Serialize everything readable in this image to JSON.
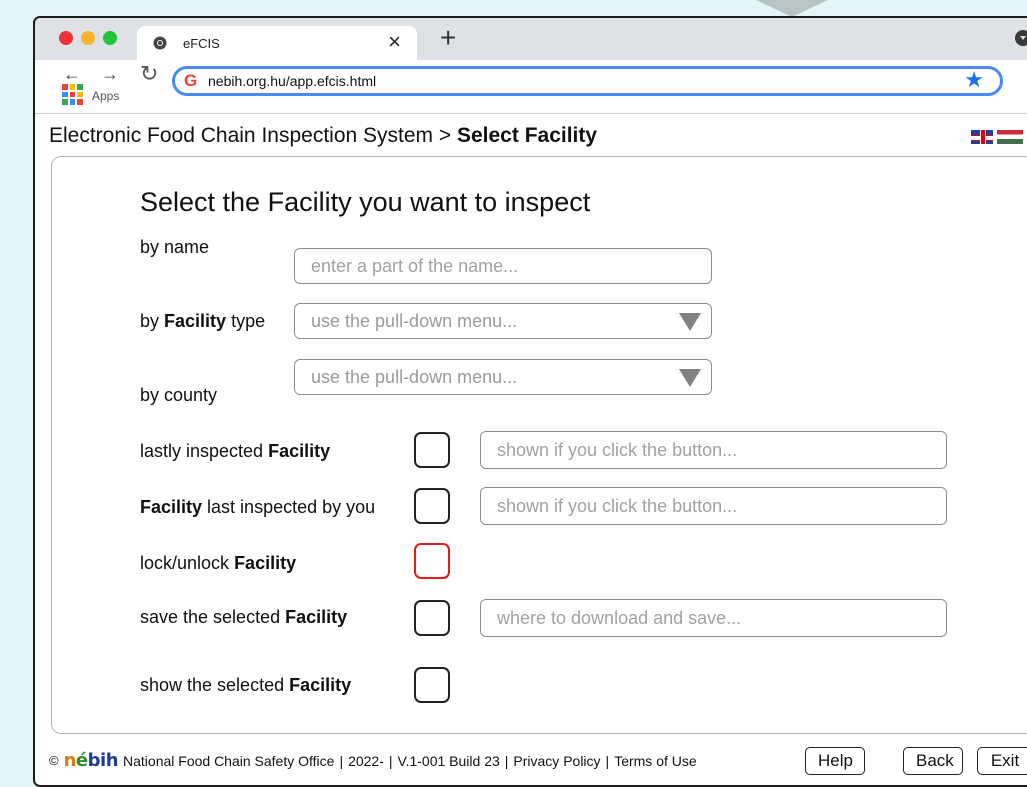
{
  "browser": {
    "tab_title": "eFCIS",
    "tab_close": "×",
    "new_tab": "+",
    "back_icon": "arrow-left-icon",
    "forward_icon": "arrow-right-icon",
    "reload_icon": "reload-icon",
    "url": "nebih.org.hu/app.efcis.html",
    "apps_label": "Apps",
    "bookmark_icon": "star-icon",
    "menu_icon": "kebab-menu-icon",
    "window_controls": {
      "close": "#f0323c",
      "minimize": "#f7b52c",
      "maximize": "#24c23c"
    }
  },
  "header": {
    "breadcrumb_root": "Electronic Food Chain Inspection System",
    "breadcrumb_sep": ">",
    "breadcrumb_current": "Select Facility",
    "languages": [
      "uk-flag",
      "hu-flag"
    ]
  },
  "form": {
    "heading": "Select the Facility you want to inspect",
    "by_name": {
      "label": "by name",
      "placeholder": "enter a part of the name..."
    },
    "by_type": {
      "label_pre": "by",
      "label_bold": "Facility",
      "label_post": "type",
      "value": "use the pull-down menu..."
    },
    "by_county": {
      "label": "by county",
      "value": "use the pull-down menu..."
    },
    "lastly_inspected": {
      "label_pre": "lastly inspected",
      "label_bold": "Facility",
      "placeholder": "shown if you click the button..."
    },
    "last_by_you": {
      "label_bold": "Facility",
      "label_post": "last inspected by you",
      "placeholder": "shown if you click the button..."
    },
    "lock_unlock": {
      "label_pre": "lock/unlock",
      "label_bold": "Facility"
    },
    "save_selected": {
      "label_pre": "save the selected",
      "label_bold": "Facility",
      "placeholder": "where to download and save..."
    },
    "show_selected": {
      "label_pre": "show the selected",
      "label_bold": "Facility"
    }
  },
  "footer": {
    "copyright": "©",
    "logo": {
      "n": "n",
      "e": "é",
      "b": "bih"
    },
    "org": "National Food Chain Safety Office",
    "year": "2022-",
    "version": "V.1-001 Build 23",
    "privacy": "Privacy Policy",
    "terms": "Terms of Use",
    "sep": "|",
    "help_label": "Help",
    "back_label": "Back",
    "exit_label": "Exit"
  },
  "colors": {
    "page_bg": "#e3f5fb",
    "omnibox_border": "#4a8af4",
    "lock_border": "#e21b1b"
  }
}
